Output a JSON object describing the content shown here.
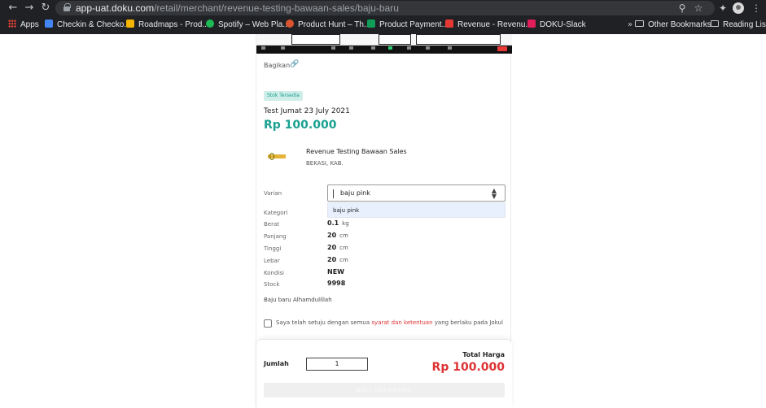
{
  "browser": {
    "url_host": "app-uat.doku.com",
    "url_path": "/retail/merchant/revenue-testing-bawaan-sales/baju-baru",
    "bookmarks": [
      {
        "label": "Apps",
        "color": "#ea4335"
      },
      {
        "label": "Checkin & Checko...",
        "color": "#4285f4"
      },
      {
        "label": "Roadmaps - Prod...",
        "color": "#f4b400"
      },
      {
        "label": "Spotify – Web Pla...",
        "color": "#1db954"
      },
      {
        "label": "Product Hunt – Th...",
        "color": "#da552f"
      },
      {
        "label": "Product Payment...",
        "color": "#0f9d58"
      },
      {
        "label": "Revenue - Revenu...",
        "color": "#e53935"
      },
      {
        "label": "DOKU-Slack",
        "color": "#e01e5a"
      }
    ],
    "other_bookmarks": "Other Bookmarks",
    "reading_list": "Reading List"
  },
  "product": {
    "share_label": "Bagikan",
    "stock_badge": "Stok Tersedia",
    "title": "Test Jumat 23 July 2021",
    "price": "Rp 100.000",
    "seller_name": "Revenue Testing Bawaan Sales",
    "seller_city": "BEKASI, KAB.",
    "variant_label": "Varian",
    "variant_value": "baju pink",
    "variant_option": "baju pink",
    "specs": {
      "kategori_label": "Kategori",
      "berat_label": "Berat",
      "berat_val": "0.1",
      "berat_unit": "kg",
      "panjang_label": "Panjang",
      "panjang_val": "20",
      "panjang_unit": "cm",
      "tinggi_label": "Tinggi",
      "tinggi_val": "20",
      "tinggi_unit": "cm",
      "lebar_label": "Lebar",
      "lebar_val": "20",
      "lebar_unit": "cm",
      "kondisi_label": "Kondisi",
      "kondisi_val": "NEW",
      "stock_label": "Stock",
      "stock_val": "9998"
    },
    "description": "Baju baru Alhamdulillah",
    "agree_pre": "Saya telah setuju dengan semua",
    "agree_link": "syarat dan ketentuan",
    "agree_post": "yang berlaku pada Jokul"
  },
  "checkout": {
    "qty_label": "Jumlah",
    "qty_value": "1",
    "total_label": "Total Harga",
    "total_value": "Rp 100.000",
    "buy_label": "BELI SEKARANG"
  }
}
